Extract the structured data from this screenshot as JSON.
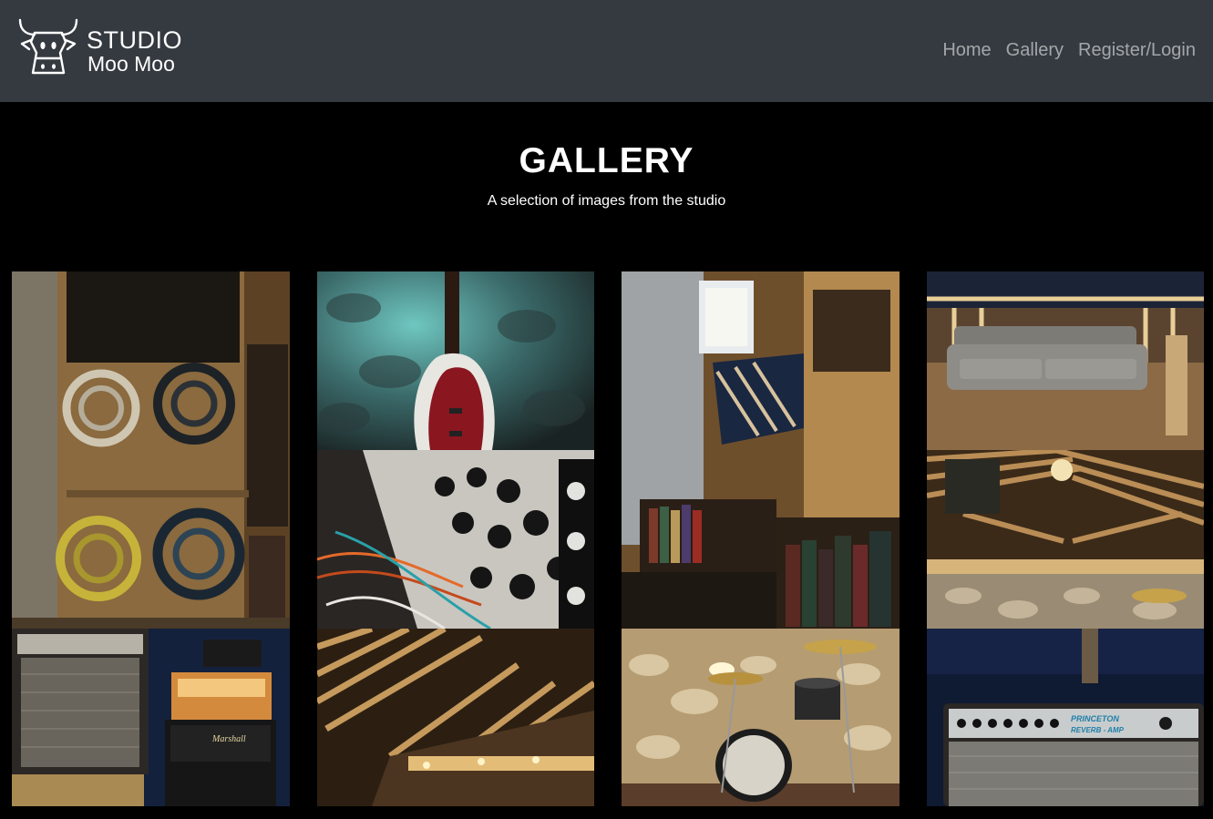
{
  "brand": {
    "line1": "STUDIO",
    "line2": "Moo Moo",
    "logo_icon": "cow-head-icon"
  },
  "nav": {
    "items": [
      {
        "label": "Home"
      },
      {
        "label": "Gallery"
      },
      {
        "label": "Register/Login"
      }
    ]
  },
  "hero": {
    "title": "GALLERY",
    "subtitle": "A selection of images from the studio"
  },
  "gallery": {
    "images": [
      {
        "subject": "cable-rack-photo"
      },
      {
        "subject": "bass-guitar-photo"
      },
      {
        "subject": "modular-synth-photo"
      },
      {
        "subject": "bookshelf-stairs-photo"
      },
      {
        "subject": "sofa-loft-photo"
      },
      {
        "subject": "slatted-ceiling-photo"
      },
      {
        "subject": "amp-stack-photo"
      },
      {
        "subject": "wood-slat-room-photo"
      },
      {
        "subject": "drum-kit-photo"
      },
      {
        "subject": "princeton-reverb-amp-photo",
        "caption": "PRINCETON REVERB - AMP"
      }
    ]
  },
  "colors": {
    "navbar_bg": "#343a40",
    "page_bg": "#000000",
    "nav_link": "rgba(255,255,255,0.55)",
    "text": "#ffffff"
  }
}
